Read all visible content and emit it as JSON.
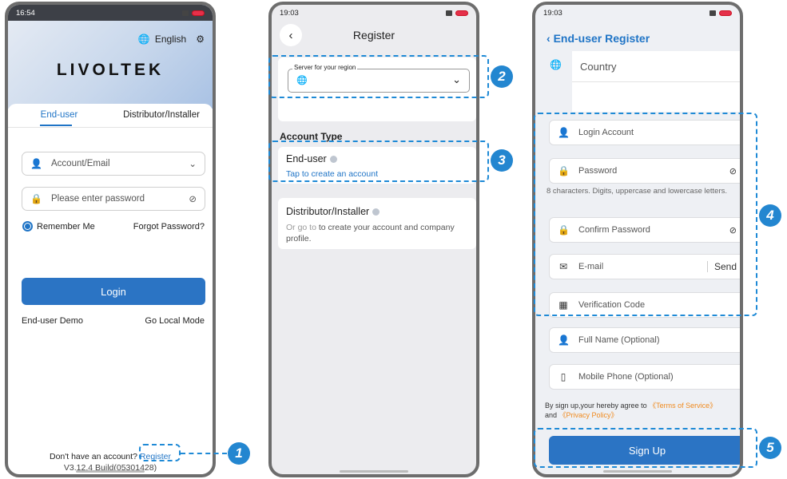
{
  "screen1": {
    "status": {
      "time": "16:54"
    },
    "language": "English",
    "logo": "LIVOLTEK",
    "tabs": [
      "End-user",
      "Distributor/Installer"
    ],
    "account_placeholder": "Account/Email",
    "password_placeholder": "Please enter password",
    "remember_me": "Remember Me",
    "forgot_password": "Forgot Password?",
    "login_button": "Login",
    "demo": "End-user Demo",
    "local_mode": "Go Local Mode",
    "no_account": "Don't have an account?",
    "register_link": "Register",
    "version": "V3.12.4 Build(05301428)"
  },
  "screen2": {
    "status": {
      "time": "19:03"
    },
    "title": "Register",
    "server_label": "Server for your region",
    "account_type": "Account Type",
    "enduser_title": "End-user",
    "enduser_link": "Tap to create an account",
    "distributor_title": "Distributor/Installer",
    "distributor_prefix": "Or go to",
    "distributor_desc": " to create your account and company profile."
  },
  "screen3": {
    "status": {
      "time": "19:03"
    },
    "title": "End-user Register",
    "country": "Country",
    "login_account": "Login Account",
    "password": "Password",
    "password_hint": "8 characters. Digits, uppercase and lowercase letters.",
    "confirm_password": "Confirm Password",
    "email": "E-mail",
    "send": "Send",
    "verification": "Verification Code",
    "full_name": "Full Name (Optional)",
    "mobile": "Mobile Phone (Optional)",
    "terms_prefix": "By sign up,your hereby agree to ",
    "terms_link": "《Terms of Service》",
    "and": "and ",
    "privacy_link": "《Privacy Policy》",
    "signup_button": "Sign Up"
  },
  "callouts": [
    "1",
    "2",
    "3",
    "4",
    "5"
  ],
  "colors": {
    "accent": "#1f74c6",
    "callout": "#2386d0",
    "link_orange": "#f08a1e"
  }
}
